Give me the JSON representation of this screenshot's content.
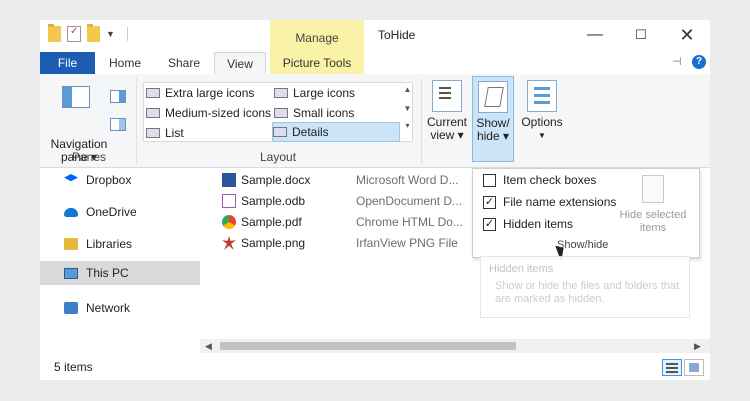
{
  "window": {
    "title": "ToHide",
    "contextual_tab_group": "Manage"
  },
  "tabs": {
    "file": "File",
    "home": "Home",
    "share": "Share",
    "view": "View",
    "picture_tools": "Picture Tools"
  },
  "ribbon": {
    "panes": {
      "label": "Panes",
      "navigation_pane": "Navigation pane ▾"
    },
    "layout": {
      "label": "Layout",
      "options": [
        "Extra large icons",
        "Large icons",
        "Medium-sized icons",
        "Small icons",
        "List",
        "Details"
      ],
      "selected": "Details"
    },
    "current_view": "Current view ▾",
    "show_hide": "Show/ hide ▾",
    "options": "Options"
  },
  "show_hide_panel": {
    "item_check_boxes": {
      "label": "Item check boxes",
      "checked": false
    },
    "file_name_extensions": {
      "label": "File name extensions",
      "checked": true
    },
    "hidden_items": {
      "label": "Hidden items",
      "checked": true
    },
    "hide_selected_items": "Hide selected items",
    "group_label": "Show/hide"
  },
  "tooltip": {
    "title": "Hidden items",
    "body": "Show or hide the files and folders that are marked as hidden."
  },
  "nav_pane": {
    "items": [
      {
        "label": "Dropbox",
        "icon": "dropbox-icon"
      },
      {
        "label": "OneDrive",
        "icon": "onedrive-icon"
      },
      {
        "label": "Libraries",
        "icon": "libraries-icon"
      },
      {
        "label": "This PC",
        "icon": "this-pc-icon",
        "selected": true
      },
      {
        "label": "Network",
        "icon": "network-icon"
      }
    ]
  },
  "files": [
    {
      "name": "Sample.docx",
      "type": "Microsoft Word D..."
    },
    {
      "name": "Sample.odb",
      "type": "OpenDocument D..."
    },
    {
      "name": "Sample.pdf",
      "type": "Chrome HTML Do..."
    },
    {
      "name": "Sample.png",
      "type": "IrfanView PNG File"
    }
  ],
  "status": {
    "item_count": "5 items"
  },
  "colors": {
    "file_tab": "#1c5db3",
    "contextual_tab": "#faf3a7",
    "selection": "#cce4f7"
  }
}
